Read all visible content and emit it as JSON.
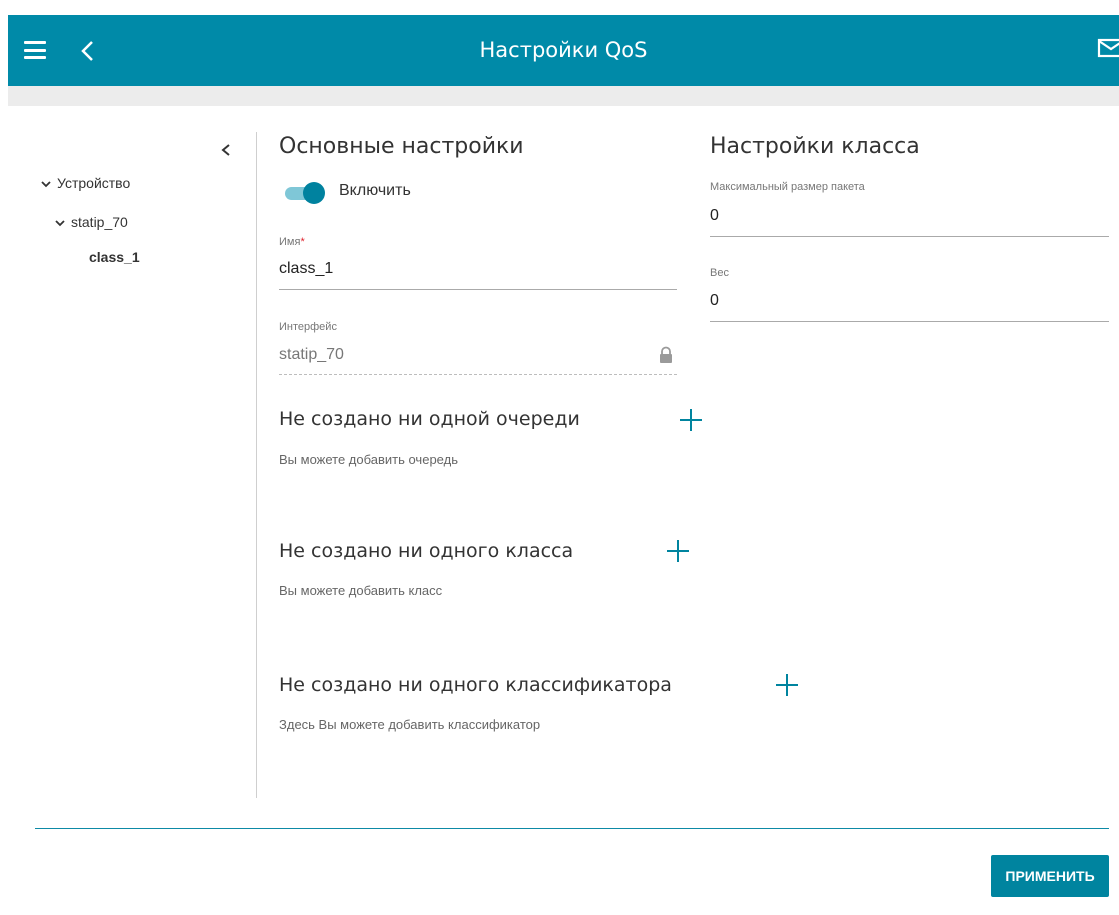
{
  "header": {
    "title": "Настройки QoS",
    "menu_icon": "hamburger-menu-icon",
    "back_icon": "chevron-left-icon",
    "mail_icon": "envelope-icon"
  },
  "sidebar": {
    "collapse_icon": "chevron-left-icon",
    "tree": [
      {
        "label": "Устройство",
        "expanded": true,
        "level": 0
      },
      {
        "label": "statip_70",
        "expanded": true,
        "level": 1
      },
      {
        "label": "class_1",
        "selected": true,
        "level": 2
      }
    ]
  },
  "main_settings": {
    "title": "Основные настройки",
    "enable_label": "Включить",
    "enable_on": true,
    "name_label": "Имя",
    "name_required_mark": "*",
    "name_value": "class_1",
    "interface_label": "Интерфейс",
    "interface_value": "statip_70"
  },
  "class_settings": {
    "title": "Настройки класса",
    "max_packet_label": "Максимальный размер пакета",
    "max_packet_value": "0",
    "weight_label": "Вес",
    "weight_value": "0"
  },
  "queues": {
    "title": "Не создано ни одной очереди",
    "subtitle": "Вы можете добавить очередь"
  },
  "classes": {
    "title": "Не создано ни одного класса",
    "subtitle": "Вы можете добавить класс"
  },
  "classifiers": {
    "title": "Не создано ни одного классификатора",
    "subtitle": "Здесь Вы можете добавить классификатор"
  },
  "footer": {
    "apply_label": "ПРИМЕНИТЬ"
  },
  "colors": {
    "accent": "#008aa8",
    "required": "#e0242e"
  }
}
